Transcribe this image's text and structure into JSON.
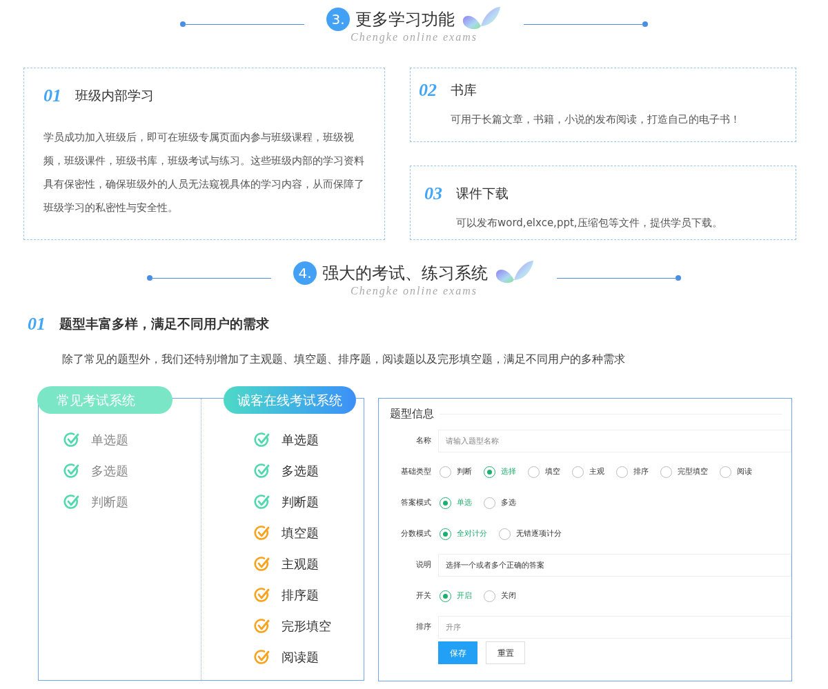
{
  "section_3": {
    "number": "3.",
    "title": "更多学习功能",
    "subtitle": "Chengke online exams"
  },
  "features": [
    {
      "number": "01",
      "title": "班级内部学习",
      "text": "学员成功加入班级后，即可在班级专属页面内参与班级课程，班级视频，班级课件，班级书库，班级考试与练习。这些班级内部的学习资料具有保密性，确保班级外的人员无法窥视具体的学习内容，从而保障了班级学习的私密性与安全性。"
    },
    {
      "number": "02",
      "title": "书库",
      "text": "可用于长篇文章，书籍，小说的发布阅读，打造自己的电子书！"
    },
    {
      "number": "03",
      "title": "课件下载",
      "text": "可以发布word,elxce,ppt,压缩包等文件，提供学员下载。"
    }
  ],
  "section_4": {
    "number": "4.",
    "title": "强大的考试、练习系统",
    "subtitle": "Chengke online exams"
  },
  "highlight": {
    "number": "01",
    "title": "题型丰富多样，满足不同用户的需求",
    "text": "除了常见的题型外，我们还特别增加了主观题、填空题、排序题，阅读题以及完形填空题，满足不同用户的多种需求"
  },
  "comparison": [
    {
      "title": "常见考试系统",
      "items": [
        {
          "label": "单选题",
          "color": "#4fd9ad"
        },
        {
          "label": "多选题",
          "color": "#4fd9ad"
        },
        {
          "label": "判断题",
          "color": "#4fd9ad"
        }
      ]
    },
    {
      "title": "诚客在线考试系统",
      "items": [
        {
          "label": "单选题",
          "color": "#4fd9ad"
        },
        {
          "label": "多选题",
          "color": "#4fd9ad"
        },
        {
          "label": "判断题",
          "color": "#4fd9ad"
        },
        {
          "label": "填空题",
          "color": "#f9a21b"
        },
        {
          "label": "主观题",
          "color": "#f9a21b"
        },
        {
          "label": "排序题",
          "color": "#f9a21b"
        },
        {
          "label": "完形填空",
          "color": "#f9a21b"
        },
        {
          "label": "阅读题",
          "color": "#f9a21b"
        }
      ]
    }
  ],
  "form": {
    "title": "题型信息",
    "rows": [
      {
        "kind": "text",
        "label": "名称",
        "placeholder": "请输入题型名称"
      },
      {
        "kind": "radio",
        "label": "基础类型",
        "options": [
          {
            "label": "判断",
            "selected": false
          },
          {
            "label": "选择",
            "selected": true
          },
          {
            "label": "填空",
            "selected": false
          },
          {
            "label": "主观",
            "selected": false
          },
          {
            "label": "排序",
            "selected": false
          },
          {
            "label": "完型填空",
            "selected": false
          },
          {
            "label": "阅读",
            "selected": false
          }
        ]
      },
      {
        "kind": "radio",
        "label": "答案模式",
        "options": [
          {
            "label": "单选",
            "selected": true
          },
          {
            "label": "多选",
            "selected": false
          }
        ]
      },
      {
        "kind": "radio",
        "label": "分数模式",
        "options": [
          {
            "label": "全对计分",
            "selected": true
          },
          {
            "label": "无错逐项计分",
            "selected": false
          }
        ]
      },
      {
        "kind": "text",
        "label": "说明",
        "value": "选择一个或者多个正确的答案"
      },
      {
        "kind": "radio",
        "label": "开关",
        "options": [
          {
            "label": "开启",
            "selected": true
          },
          {
            "label": "关闭",
            "selected": false
          }
        ]
      },
      {
        "kind": "text",
        "label": "排序",
        "placeholder": "升序"
      }
    ],
    "buttons": [
      {
        "label": "保存",
        "kind": "primary"
      },
      {
        "label": "重置",
        "kind": "default"
      }
    ]
  }
}
